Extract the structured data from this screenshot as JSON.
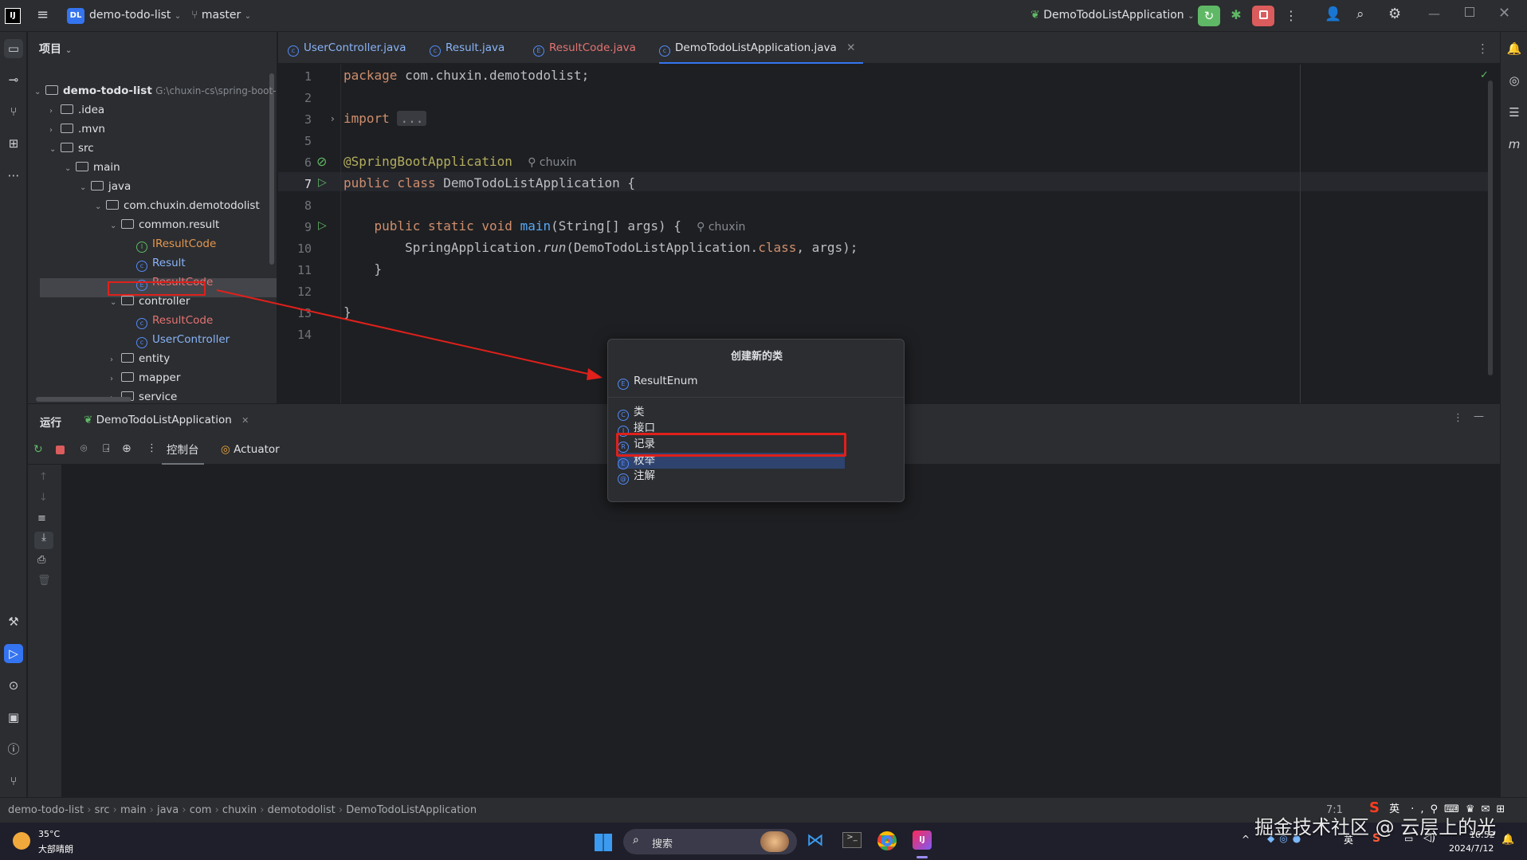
{
  "titlebar": {
    "project_badge": "DL",
    "project_name": "demo-todo-list",
    "branch": "master",
    "run_config": "DemoTodoListApplication"
  },
  "project_panel": {
    "title": "项目",
    "tree": [
      {
        "label": "demo-todo-list",
        "suffix": "G:\\chuxin-cs\\spring-boot-",
        "depth": 0,
        "kind": "root"
      },
      {
        "label": ".idea",
        "depth": 1,
        "kind": "folder"
      },
      {
        "label": ".mvn",
        "depth": 1,
        "kind": "folder"
      },
      {
        "label": "src",
        "depth": 1,
        "kind": "folder-open"
      },
      {
        "label": "main",
        "depth": 2,
        "kind": "folder-open"
      },
      {
        "label": "java",
        "depth": 3,
        "kind": "folder-open"
      },
      {
        "label": "com.chuxin.demotodolist",
        "depth": 4,
        "kind": "package-open"
      },
      {
        "label": "common.result",
        "depth": 5,
        "kind": "package-open"
      },
      {
        "label": "IResultCode",
        "depth": 6,
        "kind": "interface"
      },
      {
        "label": "Result",
        "depth": 6,
        "kind": "class"
      },
      {
        "label": "ResultCode",
        "depth": 6,
        "kind": "enum"
      },
      {
        "label": "controller",
        "depth": 5,
        "kind": "package-selected"
      },
      {
        "label": "ResultCode",
        "depth": 6,
        "kind": "class"
      },
      {
        "label": "UserController",
        "depth": 6,
        "kind": "class"
      },
      {
        "label": "entity",
        "depth": 5,
        "kind": "package"
      },
      {
        "label": "mapper",
        "depth": 5,
        "kind": "package"
      },
      {
        "label": "service",
        "depth": 5,
        "kind": "package"
      },
      {
        "label": "DemoTodoListApplication",
        "depth": 5,
        "kind": "class"
      }
    ]
  },
  "tabs": [
    {
      "label": "UserController.java"
    },
    {
      "label": "Result.java"
    },
    {
      "label": "ResultCode.java"
    },
    {
      "label": "DemoTodoListApplication.java",
      "active": true
    }
  ],
  "editor": {
    "line_numbers": [
      "1",
      "2",
      "3",
      "5",
      "6",
      "7",
      "8",
      "9",
      "10",
      "11",
      "12",
      "13",
      "14"
    ],
    "package_kw": "package",
    "package_name": " com.chuxin.demotodolist;",
    "import_kw": "import",
    "import_fold": "...",
    "annotation": "@SpringBootApplication",
    "author": "chuxin",
    "class_line": {
      "kw": "public class",
      "name": " DemoTodoListApplication {"
    },
    "main_line": {
      "kw": "public static void",
      "name": "main",
      "rest": "(String[] args) {"
    },
    "call_line": {
      "obj": "SpringApplication.",
      "method": "run",
      "arg1": "(DemoTodoListApplication.",
      "kw": "class",
      "rest": ", args);"
    },
    "close_inner": "}",
    "close_outer": "}"
  },
  "run_panel": {
    "label": "运行",
    "tab": "DemoTodoListApplication",
    "console_tab": "控制台",
    "actuator_tab": "Actuator"
  },
  "popup": {
    "title": "创建新的类",
    "name_value": "ResultEnum",
    "options": [
      {
        "label": "类",
        "badge": "C"
      },
      {
        "label": "接口",
        "badge": "I"
      },
      {
        "label": "记录",
        "badge": "R"
      },
      {
        "label": "枚举",
        "badge": "E",
        "selected": true
      },
      {
        "label": "注解",
        "badge": "@"
      }
    ]
  },
  "status_bar": {
    "breadcrumbs": [
      "demo-todo-list",
      "src",
      "main",
      "java",
      "com",
      "chuxin",
      "demotodolist",
      "DemoTodoListApplication"
    ],
    "position": "7:1"
  },
  "taskbar": {
    "temperature": "35°C",
    "weather": "大部晴朗",
    "search": "搜索",
    "ime": "英",
    "time": "16:52",
    "date": "2024/7/12",
    "watermark": "掘金技术社区 @ 云层上的光"
  },
  "colors": {
    "accent": "#3574f0",
    "selected_bg": "#2e436e",
    "red_annotation": "#e0201b",
    "green_run": "#5fb865",
    "stop_red": "#db5c5c"
  }
}
